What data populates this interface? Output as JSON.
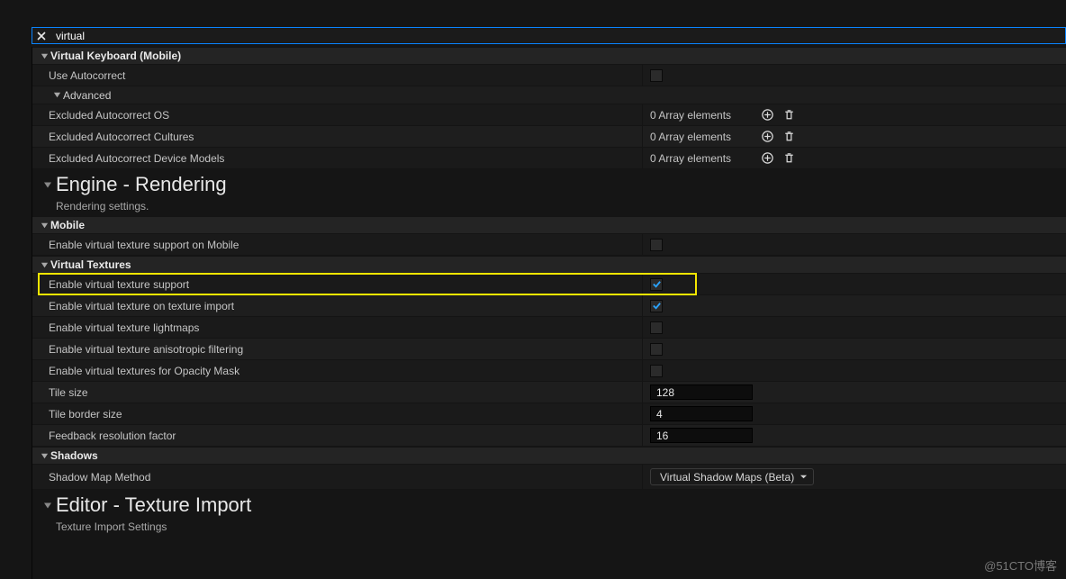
{
  "search": {
    "value": "virtual"
  },
  "section_vk": {
    "title": "Virtual Keyboard (Mobile)",
    "use_autocorrect": "Use Autocorrect",
    "advanced": "Advanced",
    "excl_os": "Excluded Autocorrect OS",
    "excl_cultures": "Excluded Autocorrect Cultures",
    "excl_models": "Excluded Autocorrect Device Models",
    "arr0": "0 Array elements"
  },
  "section_engine": {
    "title": "Engine - Rendering",
    "subtitle": "Rendering settings.",
    "cat_mobile": "Mobile",
    "mob_enable_vt": "Enable virtual texture support on Mobile",
    "cat_vt": "Virtual Textures",
    "vt_enable": "Enable virtual texture support",
    "vt_import": "Enable virtual texture on texture import",
    "vt_lightmaps": "Enable virtual texture lightmaps",
    "vt_aniso": "Enable virtual texture anisotropic filtering",
    "vt_opacity": "Enable virtual textures for Opacity Mask",
    "tile_size_label": "Tile size",
    "tile_size_value": "128",
    "tile_border_label": "Tile border size",
    "tile_border_value": "4",
    "feedback_label": "Feedback resolution factor",
    "feedback_value": "16",
    "cat_shadows": "Shadows",
    "shadow_method_label": "Shadow Map Method",
    "shadow_method_value": "Virtual Shadow Maps (Beta)"
  },
  "section_editor": {
    "title": "Editor - Texture Import",
    "subtitle": "Texture Import Settings"
  },
  "watermark": "@51CTO博客"
}
